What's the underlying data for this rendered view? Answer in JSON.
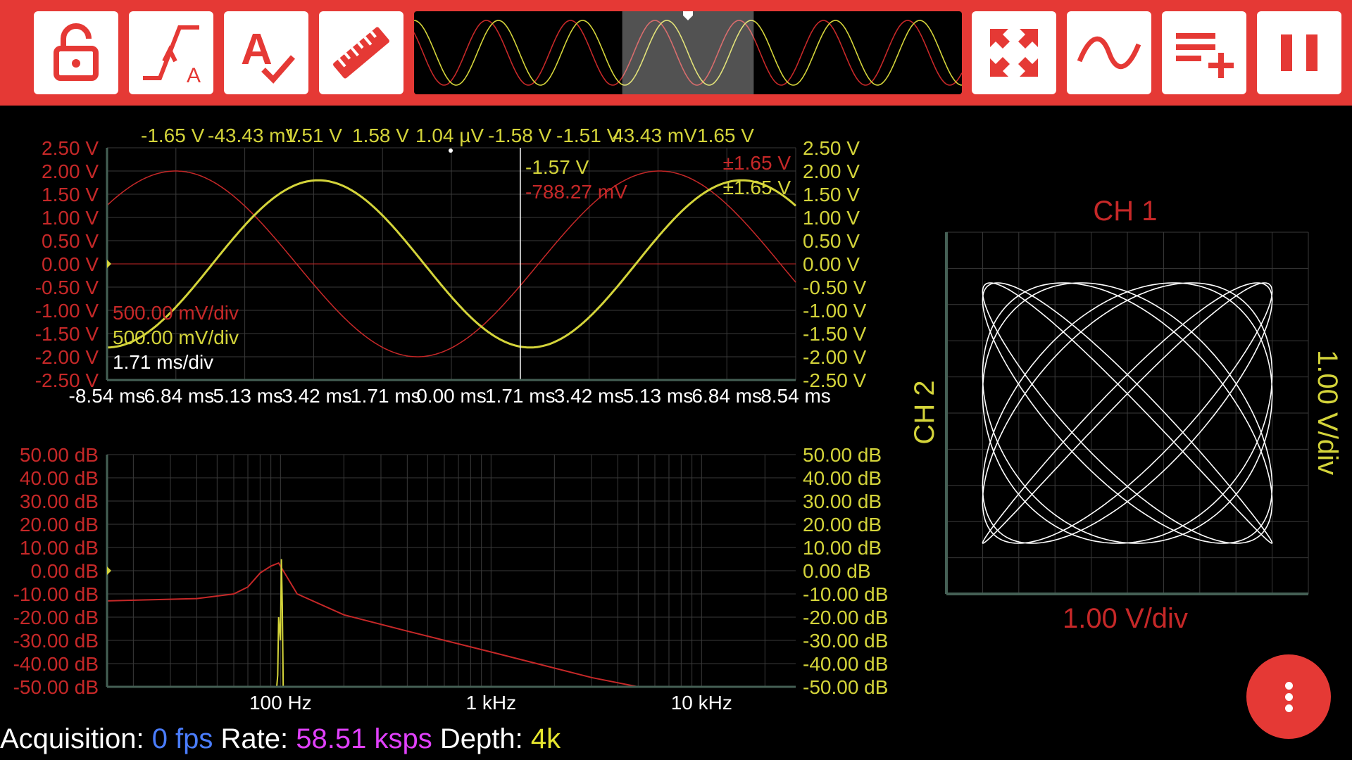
{
  "toolbar": {
    "buttons_left": [
      {
        "name": "lock-button",
        "icon": "unlocked-padlock-icon"
      },
      {
        "name": "trigger-button",
        "icon": "trigger-edge-icon",
        "badge": "A"
      },
      {
        "name": "spellcheck-button",
        "icon": "a-check-icon",
        "letter": "A"
      },
      {
        "name": "ruler-button",
        "icon": "ruler-icon"
      }
    ],
    "buttons_right": [
      {
        "name": "fullscreen-button",
        "icon": "expand-arrows-icon"
      },
      {
        "name": "waveform-button",
        "icon": "sine-wave-icon"
      },
      {
        "name": "add-list-button",
        "icon": "playlist-add-icon"
      },
      {
        "name": "pause-button",
        "icon": "pause-icon"
      }
    ],
    "overview": {
      "cycles": 6.5,
      "viewport_start": 0.38,
      "viewport_end": 0.62
    }
  },
  "time_plot": {
    "top_readouts": [
      "-1.65 V",
      "-43.43 mV",
      "1.51 V",
      "1.58 V",
      "1.04 µV",
      "-1.58 V",
      "-1.51 V",
      "43.43 mV",
      "1.65 V"
    ],
    "left_ticks": [
      "2.50 V",
      "2.00 V",
      "1.50 V",
      "1.00 V",
      "0.50 V",
      "0.00 V",
      "-0.50 V",
      "-1.00 V",
      "-1.50 V",
      "-2.00 V",
      "-2.50 V"
    ],
    "right_ticks": [
      "2.50 V",
      "2.00 V",
      "1.50 V",
      "1.00 V",
      "0.50 V",
      "0.00 V",
      "-0.50 V",
      "-1.00 V",
      "-1.50 V",
      "-2.00 V",
      "-2.50 V"
    ],
    "x_ticks": [
      "-8.54 ms",
      "-6.84 ms",
      "-5.13 ms",
      "-3.42 ms",
      "-1.71 ms",
      "0.00 ms",
      "1.71 ms",
      "3.42 ms",
      "5.13 ms",
      "6.84 ms",
      "8.54 ms"
    ],
    "x_range_ms": [
      -8.54,
      8.54
    ],
    "y_range_v": [
      -2.5,
      2.5
    ],
    "cursor_readout_ch2": "-1.57 V",
    "cursor_readout_ch1": "-788.27 mV",
    "amplitude_ch1": "±1.65 V",
    "amplitude_ch2": "±1.65 V",
    "ch1_scale": "500.00 mV/div",
    "ch2_scale": "500.00 mV/div",
    "time_scale": "1.71 ms/div",
    "ch1_wave": {
      "amplitude_v": 2.0,
      "period_ms": 12.0,
      "peak_time_ms": -6.84
    },
    "ch2_wave": {
      "amplitude_v": 1.8,
      "period_ms": 10.5,
      "peak_time_ms": -3.3
    }
  },
  "fft_plot": {
    "left_ticks": [
      "50.00 dB",
      "40.00 dB",
      "30.00 dB",
      "20.00 dB",
      "10.00 dB",
      "0.00 dB",
      "-10.00 dB",
      "-20.00 dB",
      "-30.00 dB",
      "-40.00 dB",
      "-50.00 dB"
    ],
    "right_ticks": [
      "50.00 dB",
      "40.00 dB",
      "30.00 dB",
      "20.00 dB",
      "10.00 dB",
      "0.00 dB",
      "-10.00 dB",
      "-20.00 dB",
      "-30.00 dB",
      "-40.00 dB",
      "-50.00 dB"
    ],
    "x_ticks": [
      "100 Hz",
      "1 kHz",
      "10 kHz"
    ],
    "x_range_hz": [
      15,
      28000
    ],
    "y_range_db": [
      -50,
      50
    ],
    "ch1_spectrum": [
      [
        15,
        -13
      ],
      [
        40,
        -12
      ],
      [
        60,
        -10
      ],
      [
        70,
        -7
      ],
      [
        80,
        -1
      ],
      [
        90,
        2
      ],
      [
        98,
        3.3
      ],
      [
        120,
        -10
      ],
      [
        200,
        -19
      ],
      [
        400,
        -26
      ],
      [
        1000,
        -35
      ],
      [
        3000,
        -46
      ],
      [
        5000,
        -50
      ]
    ],
    "ch2_spectrum": [
      [
        96,
        -50
      ],
      [
        97,
        -45
      ],
      [
        98,
        -20
      ],
      [
        100,
        -30
      ],
      [
        101,
        5
      ],
      [
        102,
        -15
      ],
      [
        103,
        -50
      ]
    ]
  },
  "xy_plot": {
    "x_title": "CH 1",
    "y_title": "CH 2",
    "x_scale": "1.00 V/div",
    "y_scale": "1.00 V/div",
    "range_v": [
      -2.5,
      2.5
    ],
    "lissajous": {
      "x_amplitude_v": 2.0,
      "y_amplitude_v": 1.8,
      "freq_ratio": [
        7,
        8
      ]
    }
  },
  "status": {
    "acquisition_label": "Acquisition:",
    "acquisition_value": "0 fps",
    "rate_label": "Rate:",
    "rate_value": "58.51 ksps",
    "depth_label": "Depth:",
    "depth_value": "4k"
  },
  "colors": {
    "toolbar": "#e53935",
    "ch1": "#c62828",
    "ch2": "#d4d43a",
    "grid": "#3a3a3a",
    "axis": "#456055",
    "fps": "#4a7dff",
    "rate": "#e040fb",
    "depth": "#e6e62e"
  }
}
